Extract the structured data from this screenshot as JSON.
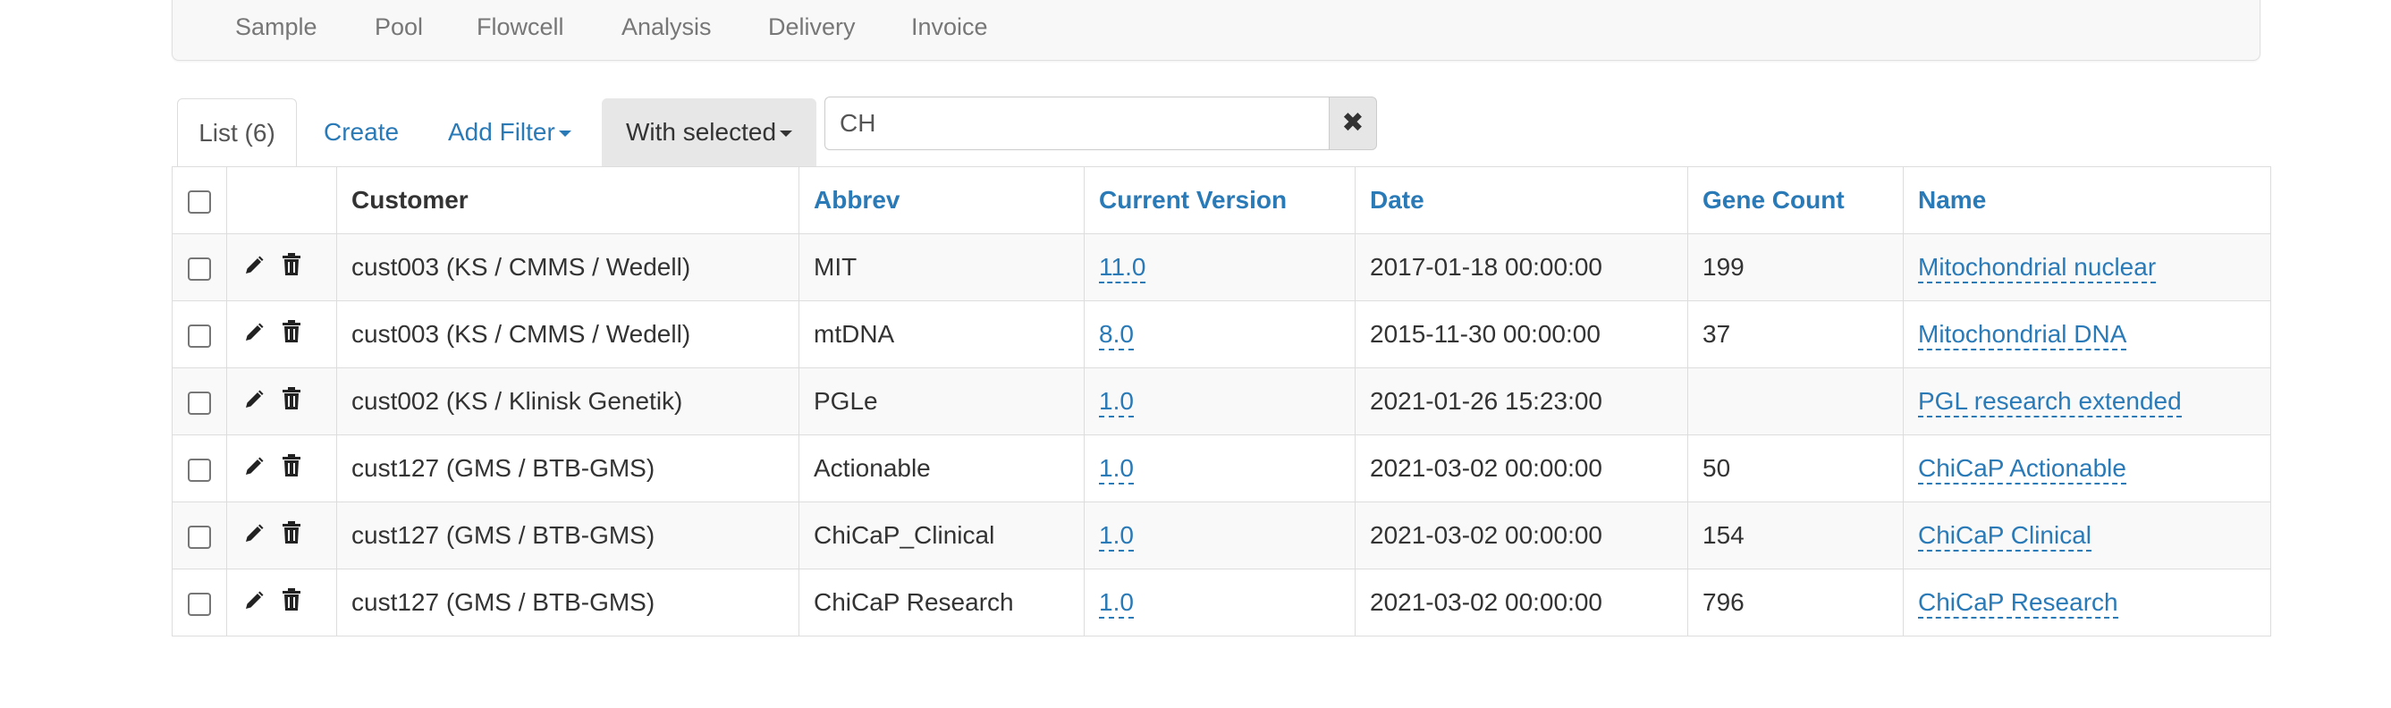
{
  "nav": {
    "items": [
      {
        "label": "Sample"
      },
      {
        "label": "Pool"
      },
      {
        "label": "Flowcell"
      },
      {
        "label": "Analysis"
      },
      {
        "label": "Delivery"
      },
      {
        "label": "Invoice"
      }
    ]
  },
  "tabs": {
    "list": "List (6)",
    "create": "Create",
    "add_filter": "Add Filter",
    "with_selected": "With selected"
  },
  "search": {
    "value": "CH",
    "clear_icon": "✖"
  },
  "table": {
    "headers": {
      "customer": "Customer",
      "abbrev": "Abbrev",
      "current_version": "Current Version",
      "date": "Date",
      "gene_count": "Gene Count",
      "name": "Name"
    },
    "rows": [
      {
        "customer": "cust003 (KS / CMMS / Wedell)",
        "abbrev": "MIT",
        "version": "11.0",
        "date": "2017-01-18 00:00:00",
        "gene_count": "199",
        "name": "Mitochondrial nuclear"
      },
      {
        "customer": "cust003 (KS / CMMS / Wedell)",
        "abbrev": "mtDNA",
        "version": "8.0",
        "date": "2015-11-30 00:00:00",
        "gene_count": "37",
        "name": "Mitochondrial DNA"
      },
      {
        "customer": "cust002 (KS / Klinisk Genetik)",
        "abbrev": "PGLe",
        "version": "1.0",
        "date": "2021-01-26 15:23:00",
        "gene_count": "",
        "name": "PGL research extended"
      },
      {
        "customer": "cust127 (GMS / BTB-GMS)",
        "abbrev": "Actionable",
        "version": "1.0",
        "date": "2021-03-02 00:00:00",
        "gene_count": "50",
        "name": "ChiCaP Actionable"
      },
      {
        "customer": "cust127 (GMS / BTB-GMS)",
        "abbrev": "ChiCaP_Clinical",
        "version": "1.0",
        "date": "2021-03-02 00:00:00",
        "gene_count": "154",
        "name": "ChiCaP Clinical"
      },
      {
        "customer": "cust127 (GMS / BTB-GMS)",
        "abbrev": "ChiCaP Research",
        "version": "1.0",
        "date": "2021-03-02 00:00:00",
        "gene_count": "796",
        "name": "ChiCaP Research"
      }
    ]
  },
  "colors": {
    "link": "#2a7ab8",
    "border": "#dddddd",
    "stripe": "#f9f9f9"
  }
}
